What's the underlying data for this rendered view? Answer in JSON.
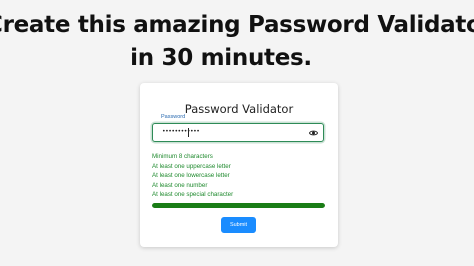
{
  "headline": {
    "line1": "Create this amazing Password Validator",
    "line2": "in 30 minutes."
  },
  "form": {
    "title": "Password Validator",
    "password_label": "Password",
    "password_value": "••••••••••••",
    "toggle_icon": "eye-icon",
    "rules": [
      "Minimum 8 characters",
      "At least one uppercase letter",
      "At least one lowercase letter",
      "At least one number",
      "At least one special character"
    ],
    "strength_fraction": 1.0,
    "submit_label": "Submit"
  },
  "colors": {
    "background": "#f4f4f4",
    "rule_met": "#1f8a2e",
    "strength_bar": "#1a7d16",
    "input_border": "#2e8b57",
    "label": "#2a6ab0",
    "submit_button": "#1a8cff"
  }
}
